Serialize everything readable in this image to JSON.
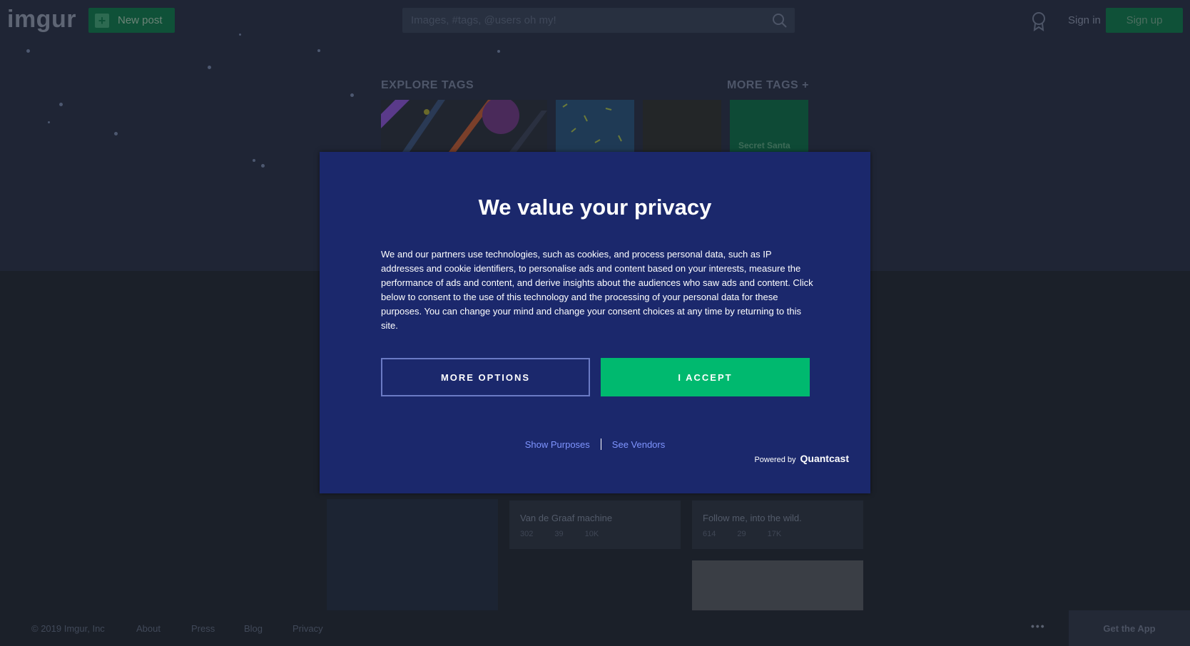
{
  "header": {
    "logo": "imgur",
    "new_post_label": "New post",
    "search_placeholder": "Images, #tags, @users oh my!",
    "signin_label": "Sign in",
    "signup_label": "Sign up"
  },
  "explore": {
    "heading": "EXPLORE TAGS",
    "more_tags": "MORE TAGS +",
    "tag_4_label": "Secret Santa"
  },
  "posts": [
    {
      "title": "Van de Graaf machine",
      "up": "302",
      "comments": "39",
      "views": "10K"
    },
    {
      "title": "Follow me, into the wild.",
      "up": "614",
      "comments": "29",
      "views": "17K"
    }
  ],
  "footer": {
    "copyright": "© 2019 Imgur, Inc",
    "about": "About",
    "press": "Press",
    "blog": "Blog",
    "privacy": "Privacy",
    "get_app": "Get the App"
  },
  "modal": {
    "title": "We value your privacy",
    "body": "We and our partners use technologies, such as cookies, and process personal data, such as IP addresses and cookie identifiers, to personalise ads and content based on your interests, measure the performance of ads and content, and derive insights about the audiences who saw ads and content. Click below to consent to the use of this technology and the processing of your personal data for these purposes. You can change your mind and change your consent choices at any time by returning to this site.",
    "more_options": "MORE OPTIONS",
    "accept": "I ACCEPT",
    "show_purposes": "Show Purposes",
    "see_vendors": "See Vendors",
    "powered_by": "Powered by",
    "brand": "Quantcast"
  },
  "colors": {
    "modal_bg": "#1b286c",
    "accept_green": "#00b96f",
    "link_blue": "#7f95ff",
    "page_bg": "#1b2029"
  }
}
